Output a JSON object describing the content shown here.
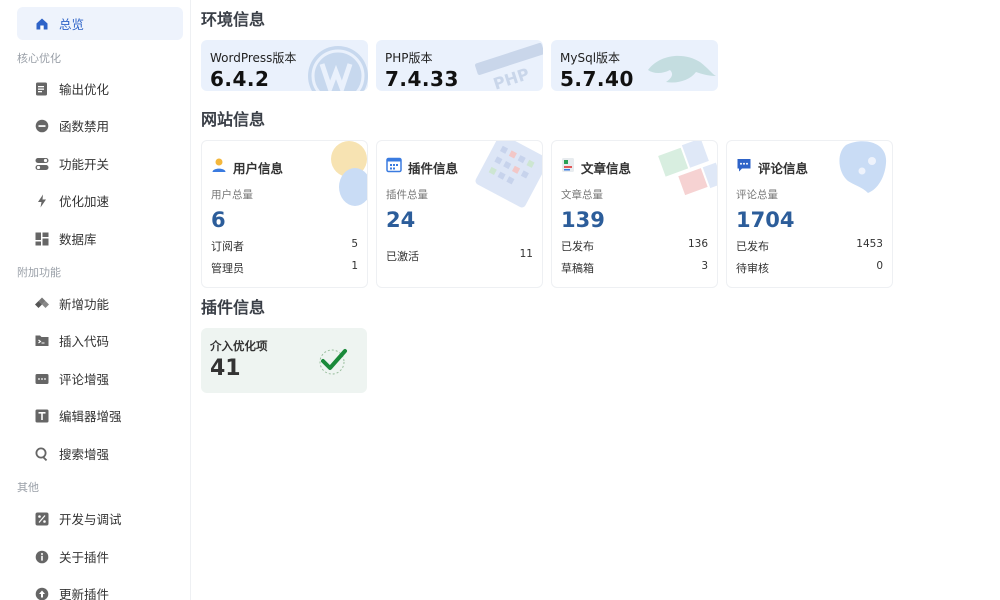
{
  "sidebar": {
    "overview": "总览",
    "groups": {
      "core": "核心优化",
      "extra": "附加功能",
      "other": "其他"
    },
    "items": {
      "output": "输出优化",
      "functions": "函数禁用",
      "toggles": "功能开关",
      "speed": "优化加速",
      "database": "数据库",
      "new_features": "新增功能",
      "insert_code": "插入代码",
      "comments": "评论增强",
      "editor": "编辑器增强",
      "search": "搜索增强",
      "dev_debug": "开发与调试",
      "about": "关于插件",
      "update": "更新插件"
    }
  },
  "env": {
    "title": "环境信息",
    "wordpress": {
      "label": "WordPress版本",
      "value": "6.4.2"
    },
    "php": {
      "label": "PHP版本",
      "value": "7.4.33",
      "deco_text": "PHP"
    },
    "mysql": {
      "label": "MySql版本",
      "value": "5.7.40"
    }
  },
  "site": {
    "title": "网站信息",
    "users": {
      "title": "用户信息",
      "sub": "用户总量",
      "total": "6",
      "rows": [
        {
          "k": "订阅者",
          "v": "5"
        },
        {
          "k": "管理员",
          "v": "1"
        }
      ]
    },
    "plugins": {
      "title": "插件信息",
      "sub": "插件总量",
      "total": "24",
      "rows": [
        {
          "k": "已激活",
          "v": "11"
        }
      ]
    },
    "posts": {
      "title": "文章信息",
      "sub": "文章总量",
      "total": "139",
      "rows": [
        {
          "k": "已发布",
          "v": "136"
        },
        {
          "k": "草稿箱",
          "v": "3"
        }
      ]
    },
    "comments": {
      "title": "评论信息",
      "sub": "评论总量",
      "total": "1704",
      "rows": [
        {
          "k": "已发布",
          "v": "1453"
        },
        {
          "k": "待审核",
          "v": "0"
        }
      ]
    }
  },
  "plugin": {
    "title": "插件信息",
    "card": {
      "label": "介入优化项",
      "value": "41"
    }
  },
  "colors": {
    "accent": "#2e63c8",
    "active_bg": "#eef3fc",
    "env_card_bg": "#eaf1fc",
    "number_blue": "#2c5d9a",
    "check_green": "#1a8a3a"
  }
}
